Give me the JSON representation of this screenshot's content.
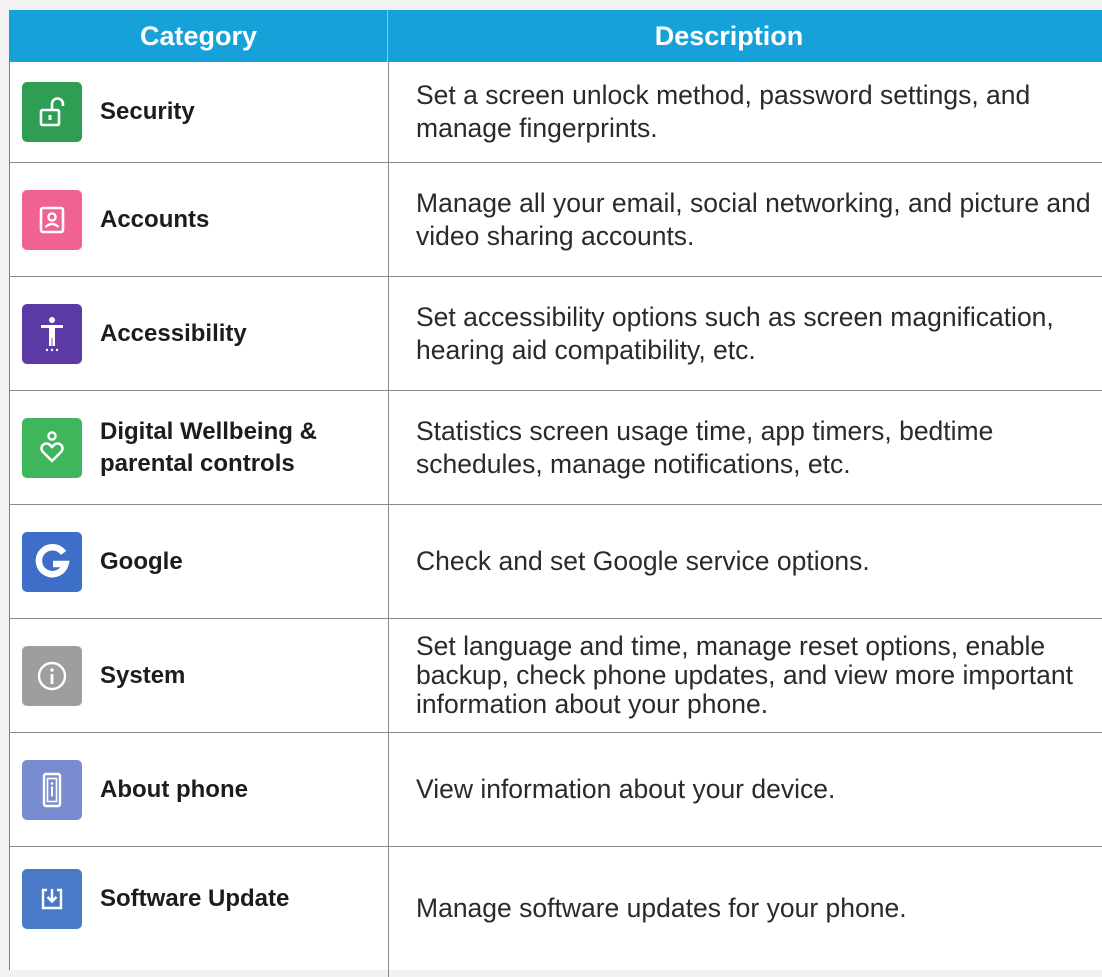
{
  "header": {
    "category": "Category",
    "description": "Description"
  },
  "colors": {
    "header_bg": "#16a2d8"
  },
  "rows": [
    {
      "label": "Security",
      "description": "Set a screen unlock method, password settings, and manage fingerprints.",
      "icon": "unlock-icon",
      "color": "#2e9e52"
    },
    {
      "label": "Accounts",
      "description": "Manage all your email, social networking, and picture and video sharing accounts.",
      "icon": "account-icon",
      "color": "#f0628f"
    },
    {
      "label": "Accessibility",
      "description": "Set accessibility options such as screen magnification, hearing aid compatibility, etc.",
      "icon": "accessibility-icon",
      "color": "#5b3aa6"
    },
    {
      "label": "Digital Wellbeing & parental controls",
      "description": "Statistics screen usage time, app timers, bedtime schedules, manage notifications, etc.",
      "icon": "wellbeing-heart-icon",
      "color": "#3fb55c"
    },
    {
      "label": "Google",
      "description": "Check and set Google service options.",
      "icon": "google-g-icon",
      "color": "#3d6fc8"
    },
    {
      "label": "System",
      "description": "Set language and time, manage reset options, enable backup, check phone updates, and view more important information about your phone.",
      "icon": "info-icon",
      "color": "#9e9e9e"
    },
    {
      "label": "About phone",
      "description": "View information about your device.",
      "icon": "phone-info-icon",
      "color": "#7a8cd0"
    },
    {
      "label": "Software Update",
      "description": "Manage software updates for your phone.",
      "icon": "download-icon",
      "color": "#4a79c8"
    }
  ]
}
